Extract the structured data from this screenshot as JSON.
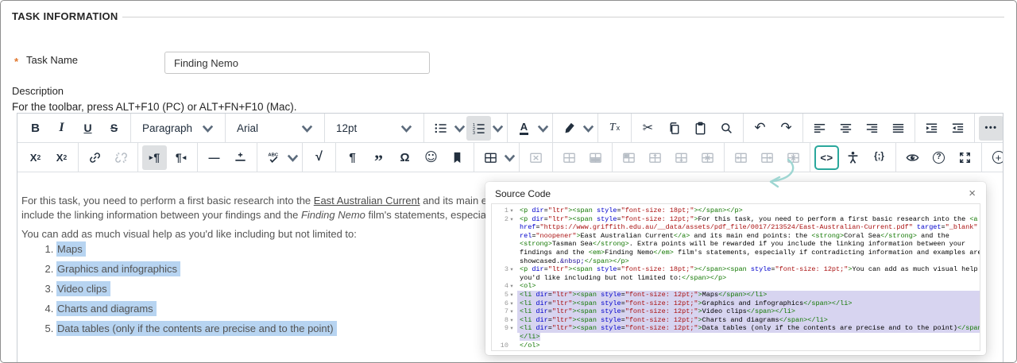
{
  "header": {
    "title": "TASK INFORMATION"
  },
  "task_name": {
    "required_marker": "*",
    "label": "Task Name",
    "value": "Finding Nemo"
  },
  "description": {
    "label": "Description",
    "hint": "For the toolbar, press ALT+F10 (PC) or ALT+FN+F10 (Mac)."
  },
  "colors": {
    "accent_teal": "#2aa79c",
    "annotation_arrow": "#9ed6d2",
    "icon": "#222f3e",
    "disabled_icon": "#b6bdc5",
    "active_button_bg": "#dee0e2",
    "content_selection": "#b7d4f1",
    "code_selection": "#d7d4f0",
    "required_marker": "#e0762c",
    "code_tag": "#117700",
    "code_attribute": "#0000cc",
    "code_string": "#aa1111",
    "code_entity": "#221199"
  },
  "toolbar": {
    "rows": [
      [
        [
          {
            "name": "bold"
          },
          {
            "name": "italic"
          },
          {
            "name": "underline"
          },
          {
            "name": "strikethrough"
          }
        ],
        [
          {
            "name": "paragraph-style",
            "type": "select",
            "label": "Paragraph",
            "width": 110
          }
        ],
        [
          {
            "name": "font-family",
            "type": "select",
            "label": "Arial",
            "width": 116
          }
        ],
        [
          {
            "name": "font-size",
            "type": "select",
            "label": "12pt",
            "width": 116
          }
        ],
        [
          {
            "name": "bullet-list",
            "menu": true
          },
          {
            "name": "numbered-list",
            "menu": true,
            "state": "active"
          }
        ],
        [
          {
            "name": "text-color",
            "menu": true
          }
        ],
        [
          {
            "name": "highlight-color",
            "menu": true
          }
        ],
        [
          {
            "name": "clear-formatting"
          }
        ],
        [
          {
            "name": "cut"
          },
          {
            "name": "copy"
          },
          {
            "name": "paste"
          },
          {
            "name": "find-replace"
          }
        ],
        [
          {
            "name": "undo"
          },
          {
            "name": "redo"
          }
        ],
        [
          {
            "name": "align-left"
          },
          {
            "name": "align-center"
          },
          {
            "name": "align-right"
          },
          {
            "name": "justify"
          }
        ],
        [
          {
            "name": "indent"
          },
          {
            "name": "outdent"
          }
        ],
        [
          {
            "name": "more-options",
            "state": "active"
          }
        ]
      ],
      [
        [
          {
            "name": "superscript"
          },
          {
            "name": "subscript"
          }
        ],
        [
          {
            "name": "insert-link"
          },
          {
            "name": "remove-link",
            "state": "disabled"
          }
        ],
        [
          {
            "name": "left-to-right",
            "state": "active"
          },
          {
            "name": "right-to-left"
          }
        ],
        [
          {
            "name": "horizontal-rule"
          },
          {
            "name": "page-break"
          }
        ],
        [
          {
            "name": "spellcheck",
            "menu": true
          }
        ],
        [
          {
            "name": "math-editor"
          }
        ],
        [
          {
            "name": "paragraph-mark"
          },
          {
            "name": "blockquote"
          },
          {
            "name": "special-character"
          },
          {
            "name": "emoticons"
          },
          {
            "name": "anchor"
          }
        ],
        [
          {
            "name": "insert-table",
            "menu": true
          }
        ],
        [
          {
            "name": "delete-table",
            "state": "disabled"
          }
        ],
        [
          {
            "name": "table-properties",
            "state": "disabled"
          },
          {
            "name": "row-properties",
            "state": "disabled"
          }
        ],
        [
          {
            "name": "cell-properties",
            "state": "disabled"
          },
          {
            "name": "insert-row-above",
            "state": "disabled"
          },
          {
            "name": "insert-row-below",
            "state": "disabled"
          },
          {
            "name": "delete-row",
            "state": "disabled"
          }
        ],
        [
          {
            "name": "insert-column-before",
            "state": "disabled"
          },
          {
            "name": "insert-column-after",
            "state": "disabled"
          },
          {
            "name": "delete-column",
            "state": "disabled"
          }
        ],
        [
          {
            "name": "source-code",
            "state": "focused"
          },
          {
            "name": "accessibility-checker"
          },
          {
            "name": "code-sample"
          }
        ],
        [
          {
            "name": "preview"
          },
          {
            "name": "help"
          },
          {
            "name": "fullscreen"
          }
        ],
        [
          {
            "name": "add-element"
          }
        ]
      ]
    ]
  },
  "content": {
    "paragraph1_lines": [
      [
        {
          "text": "For this task, you need to perform a first basic research into the "
        },
        {
          "text": "East Australian Current",
          "style": "link"
        },
        {
          "text": " and its main end points: the "
        },
        {
          "text": "Coral Sea",
          "style": "bold"
        },
        {
          "text": " and the "
        },
        {
          "text": "Tasman Sea",
          "style": "bold"
        },
        {
          "text": ". Extra points will be rewarded if you"
        }
      ],
      [
        {
          "text": "include the linking information between your findings and the "
        },
        {
          "text": "Finding Nemo",
          "style": "italic"
        },
        {
          "text": " film's statements, especially if contradicting information and examples are showcased."
        }
      ]
    ],
    "paragraph2": "You can add as much visual help as you'd like including but not limited to:",
    "list_items": [
      "Maps",
      "Graphics and infographics",
      "Video clips",
      "Charts and diagrams",
      "Data tables (only if the contents are precise and to the point)"
    ]
  },
  "source_dialog": {
    "title": "Source Code",
    "close_glyph": "×",
    "fold_glyph": "▾",
    "rows": [
      {
        "n": "1",
        "fold": true,
        "text": "<p dir=\"ltr\"><span style=\"font-size: 18pt;\"></span></p>"
      },
      {
        "n": "2",
        "fold": true,
        "text": "<p dir=\"ltr\"><span style=\"font-size: 12pt;\">For this task, you need to perform a first basic research into the <a"
      },
      {
        "text": "href=\"https://www.griffith.edu.au/__data/assets/pdf_file/0017/213524/East-Australian-Current.pdf\" target=\"_blank\""
      },
      {
        "text": "rel=\"noopener\">East Australian Current</a> and its main end points: the <strong>Coral Sea</strong> and the"
      },
      {
        "text": "<strong>Tasman Sea</strong>. Extra points will be rewarded if you include the linking information between your"
      },
      {
        "text": "findings and the <em>Finding Nemo</em> film's statements, especially if contradicting information and examples are"
      },
      {
        "text": "showcased.&nbsp;</span></p>"
      },
      {
        "n": "3",
        "fold": true,
        "text": "<p dir=\"ltr\"><span style=\"font-size: 18pt;\"></span><span style=\"font-size: 12pt;\">You can add as much visual help as"
      },
      {
        "text": "you'd like including but not limited to:</span></p>"
      },
      {
        "n": "4",
        "fold": true,
        "text": "<ol>"
      },
      {
        "n": "5",
        "fold": true,
        "sel": "line",
        "text": "<li dir=\"ltr\"><span style=\"font-size: 12pt;\">Maps</span></li>"
      },
      {
        "n": "6",
        "fold": true,
        "sel": "line",
        "text": "<li dir=\"ltr\"><span style=\"font-size: 12pt;\">Graphics and infographics</span></li>"
      },
      {
        "n": "7",
        "fold": true,
        "sel": "line",
        "text": "<li dir=\"ltr\"><span style=\"font-size: 12pt;\">Video clips</span></li>"
      },
      {
        "n": "8",
        "fold": true,
        "sel": "line",
        "text": "<li dir=\"ltr\"><span style=\"font-size: 12pt;\">Charts and diagrams</span></li>"
      },
      {
        "n": "9",
        "fold": true,
        "sel": "line",
        "text": "<li dir=\"ltr\"><span style=\"font-size: 12pt;\">Data tables (only if the contents are precise and to the point)</span>"
      },
      {
        "sel": "text",
        "text": "</li>"
      },
      {
        "n": "10",
        "text": "</ol>"
      }
    ]
  }
}
